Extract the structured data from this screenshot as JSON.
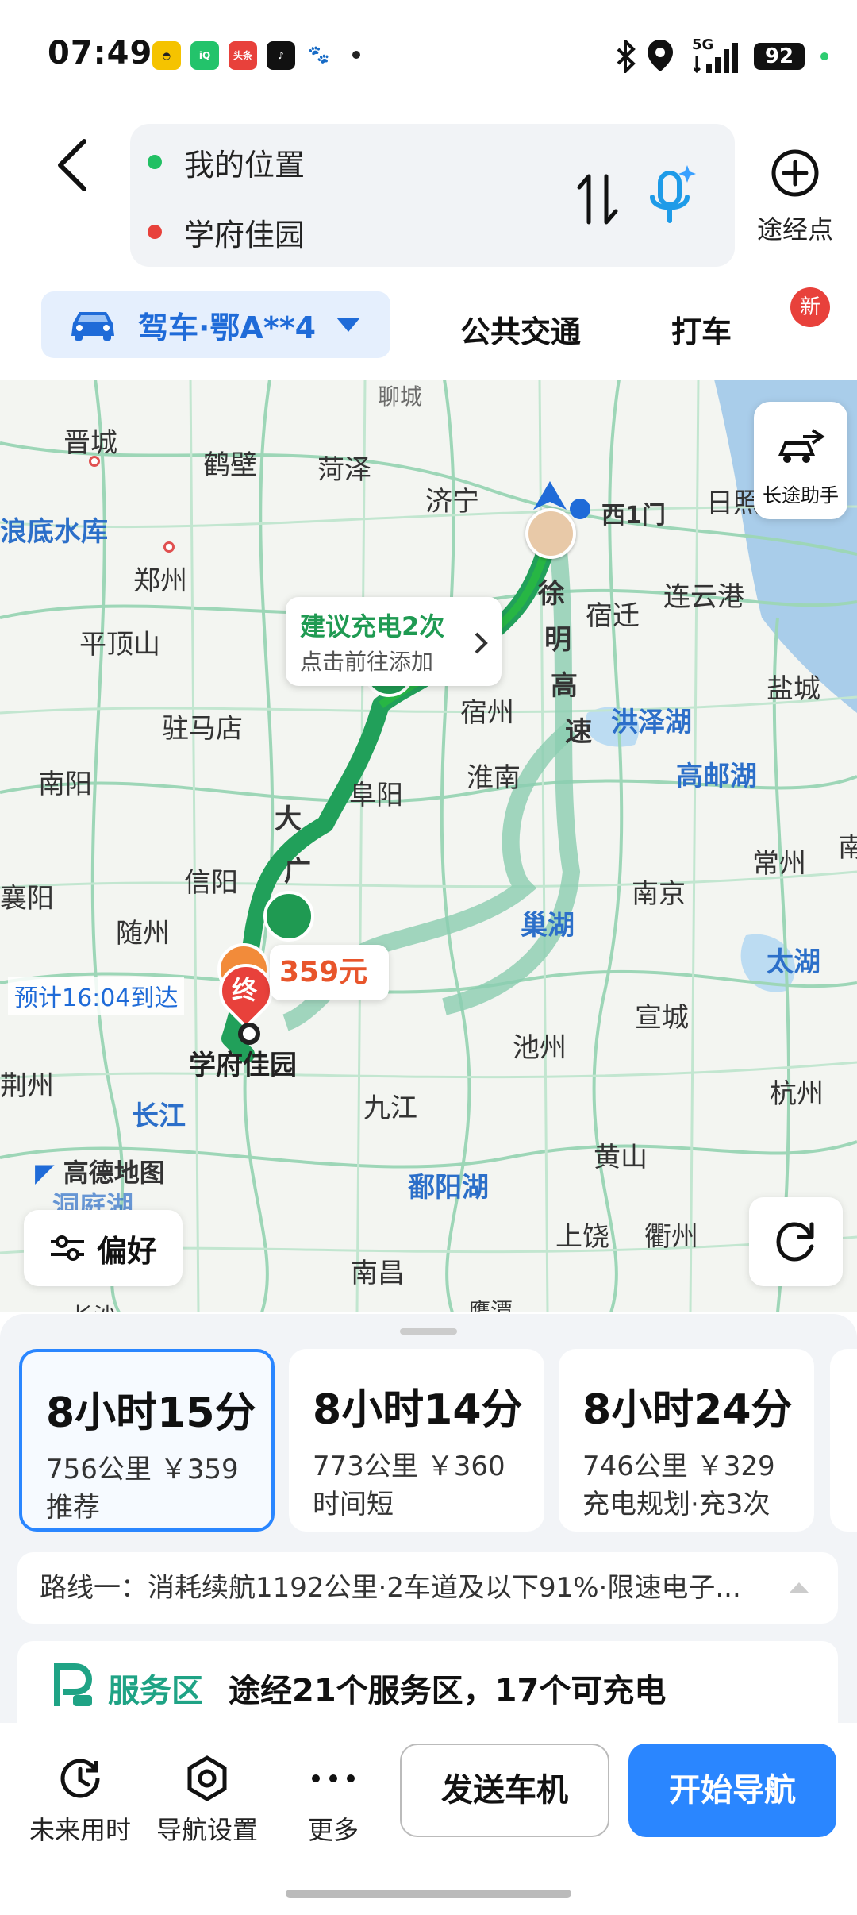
{
  "status_bar": {
    "time": "07:49",
    "network": "5G",
    "battery": "92",
    "app_icons": [
      "taxi-app-icon",
      "iqiyi-app-icon",
      "toutiao-app-icon",
      "tiktok-app-icon",
      "baidu-app-icon"
    ]
  },
  "search": {
    "origin": "我的位置",
    "destination": "学府佳园",
    "origin_color": "#22c064",
    "destination_color": "#e8413b",
    "waypoint_label": "途经点"
  },
  "modes": {
    "drive": "驾车·鄂A**4",
    "transit": "公共交通",
    "taxi": "打车",
    "new_badge": "新",
    "accent": "#1f6bd8"
  },
  "map": {
    "long_trip_label": "长途助手",
    "charge_tip_title": "建议充电2次",
    "charge_tip_sub": "点击前往添加",
    "price_tip": "359元",
    "eta": "预计16:04到达",
    "destination_label": "学府佳园",
    "end_marker": "终",
    "west_gate": "西1门",
    "road_labels": [
      "徐",
      "明",
      "高",
      "速",
      "大",
      "广"
    ],
    "logo": "高德地图",
    "preference_btn": "偏好",
    "cities": [
      "晋城",
      "鹤壁",
      "菏泽",
      "济宁",
      "日照",
      "郑州",
      "宿迁",
      "连云港",
      "平顶山",
      "宿州",
      "盐城",
      "驻马店",
      "洪泽湖",
      "南阳",
      "阜阳",
      "淮南",
      "高邮湖",
      "信阳",
      "南京",
      "常州",
      "襄阳",
      "随州",
      "巢湖",
      "太湖",
      "宣城",
      "池州",
      "荆州",
      "长江",
      "九江",
      "杭州",
      "黄山",
      "鄱阳湖",
      "上饶",
      "衢州",
      "南昌",
      "洞庭湖",
      "鹰潭",
      "长沙",
      "浪底水库",
      "聊城",
      "南"
    ]
  },
  "routes": [
    {
      "time": "8小时15分",
      "dist": "756公里 ￥359",
      "tag": "推荐",
      "selected": true
    },
    {
      "time": "8小时14分",
      "dist": "773公里 ￥360",
      "tag": "时间短",
      "selected": false
    },
    {
      "time": "8小时24分",
      "dist": "746公里 ￥329",
      "tag": "充电规划·充3次",
      "selected": false
    }
  ],
  "route_desc": "路线一：消耗续航1192公里·2车道及以下91%·限速电子...",
  "service": {
    "label": "服务区",
    "text": "途经21个服务区，17个可充电"
  },
  "bottom": {
    "future": "未来用时",
    "nav_settings": "导航设置",
    "more": "更多",
    "send": "发送车机",
    "start": "开始导航"
  }
}
